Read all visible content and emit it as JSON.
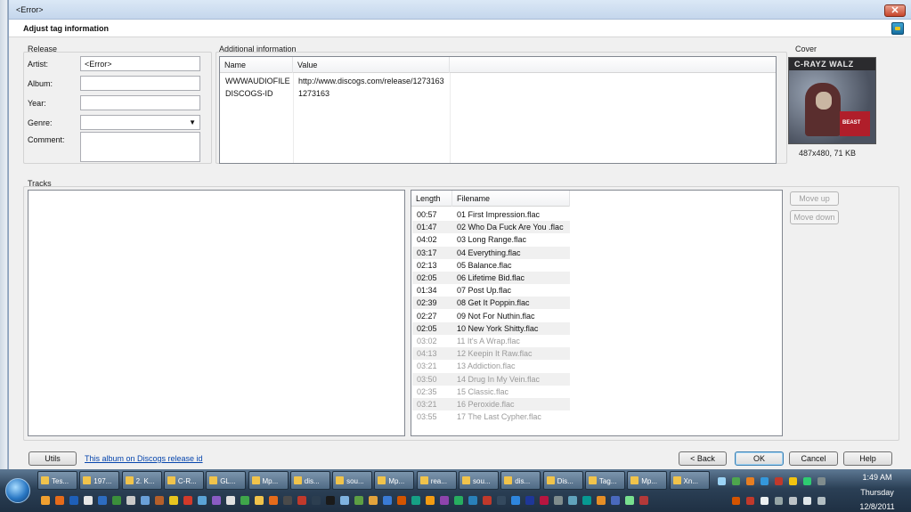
{
  "window": {
    "title": "<Error>",
    "close_glyph": "✕",
    "header_title": "Adjust tag information"
  },
  "release": {
    "group_label": "Release",
    "artist_label": "Artist:",
    "artist_value": "<Error>",
    "album_label": "Album:",
    "album_value": "",
    "year_label": "Year:",
    "year_value": "",
    "genre_label": "Genre:",
    "genre_value": "",
    "comment_label": "Comment:",
    "comment_value": ""
  },
  "additional": {
    "group_label": "Additional information",
    "columns": [
      "Name",
      "Value"
    ],
    "rows": [
      {
        "name": "WWWAUDIOFILE",
        "value": "http://www.discogs.com/release/1273163"
      },
      {
        "name": "DISCOGS-ID",
        "value": "1273163"
      }
    ]
  },
  "cover": {
    "group_label": "Cover",
    "band_text": "C-RAYZ WALZ",
    "art_text": "BEAST",
    "info": "487x480, 71 KB"
  },
  "tracks": {
    "group_label": "Tracks",
    "columns": [
      "Length",
      "Filename"
    ],
    "rows": [
      {
        "length": "00:57",
        "filename": "01 First Impression.flac",
        "dim": false
      },
      {
        "length": "01:47",
        "filename": "02 Who Da Fuck Are You .flac",
        "dim": false
      },
      {
        "length": "04:02",
        "filename": "03 Long Range.flac",
        "dim": false
      },
      {
        "length": "03:17",
        "filename": "04 Everything.flac",
        "dim": false
      },
      {
        "length": "02:13",
        "filename": "05 Balance.flac",
        "dim": false
      },
      {
        "length": "02:05",
        "filename": "06 Lifetime Bid.flac",
        "dim": false
      },
      {
        "length": "01:34",
        "filename": "07 Post Up.flac",
        "dim": false
      },
      {
        "length": "02:39",
        "filename": "08 Get It Poppin.flac",
        "dim": false
      },
      {
        "length": "02:27",
        "filename": "09 Not For Nuthin.flac",
        "dim": false
      },
      {
        "length": "02:05",
        "filename": "10 New York Shitty.flac",
        "dim": false
      },
      {
        "length": "03:02",
        "filename": "11 It's A Wrap.flac",
        "dim": true
      },
      {
        "length": "04:13",
        "filename": "12 Keepin It Raw.flac",
        "dim": true
      },
      {
        "length": "03:21",
        "filename": "13 Addiction.flac",
        "dim": true
      },
      {
        "length": "03:50",
        "filename": "14 Drug In My Vein.flac",
        "dim": true
      },
      {
        "length": "02:35",
        "filename": "15 Classic.flac",
        "dim": true
      },
      {
        "length": "03:21",
        "filename": "16 Peroxide.flac",
        "dim": true
      },
      {
        "length": "03:55",
        "filename": "17 The Last Cypher.flac",
        "dim": true
      }
    ],
    "move_up": "Move up",
    "move_down": "Move down"
  },
  "footer": {
    "utils": "Utils",
    "link": "This album on Discogs release id",
    "back": "< Back",
    "ok": "OK",
    "cancel": "Cancel",
    "help": "Help"
  },
  "taskbar": {
    "tasks": [
      "Tes...",
      "197...",
      "2. K...",
      "C-R...",
      "GL...",
      "Mp...",
      "dis...",
      "sou...",
      "Mp...",
      "rea...",
      "sou...",
      "dis...",
      "Dis...",
      "Tag...",
      "Mp...",
      "Xn..."
    ],
    "time": "1:49 AM",
    "day": "Thursday",
    "date": "12/8/2011"
  },
  "colors": {
    "link": "#0645ad",
    "dim_text": "#9a9a9a",
    "taskbar": "#2b4056"
  }
}
